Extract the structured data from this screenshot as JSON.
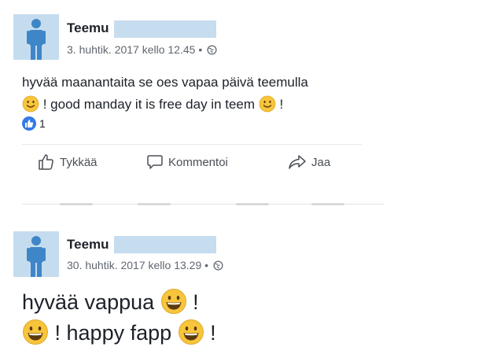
{
  "posts": [
    {
      "author_name": "Teemu",
      "timestamp": "3. huhtik. 2017 kello 12.45 •",
      "privacy_icon": "globe-icon",
      "text_line1": "hyvää maanantaita se oes vapaa päivä teemulla",
      "text_line2_mid": "! good manday it is free day in teem",
      "text_line2_end": "!",
      "emoji": "slight-smile-emoji",
      "like_count": "1",
      "actions": {
        "like": "Tykkää",
        "comment": "Kommentoi",
        "share": "Jaa"
      }
    },
    {
      "author_name": "Teemu",
      "timestamp": "30. huhtik. 2017 kello 13.29 •",
      "privacy_icon": "globe-icon",
      "text_line1": "hyvää vappua",
      "text_line1_end": "!",
      "text_line2_mid": "! happy fapp",
      "text_line2_end": "!",
      "emoji": "grin-emoji"
    }
  ],
  "colors": {
    "redaction": "#c6dcef",
    "avatar_bg": "#c5dcee",
    "avatar_figure": "#3f86c8",
    "like_blue": "#3578e5",
    "meta_gray": "#606770",
    "emoji_yellow": "#f7c53c"
  }
}
